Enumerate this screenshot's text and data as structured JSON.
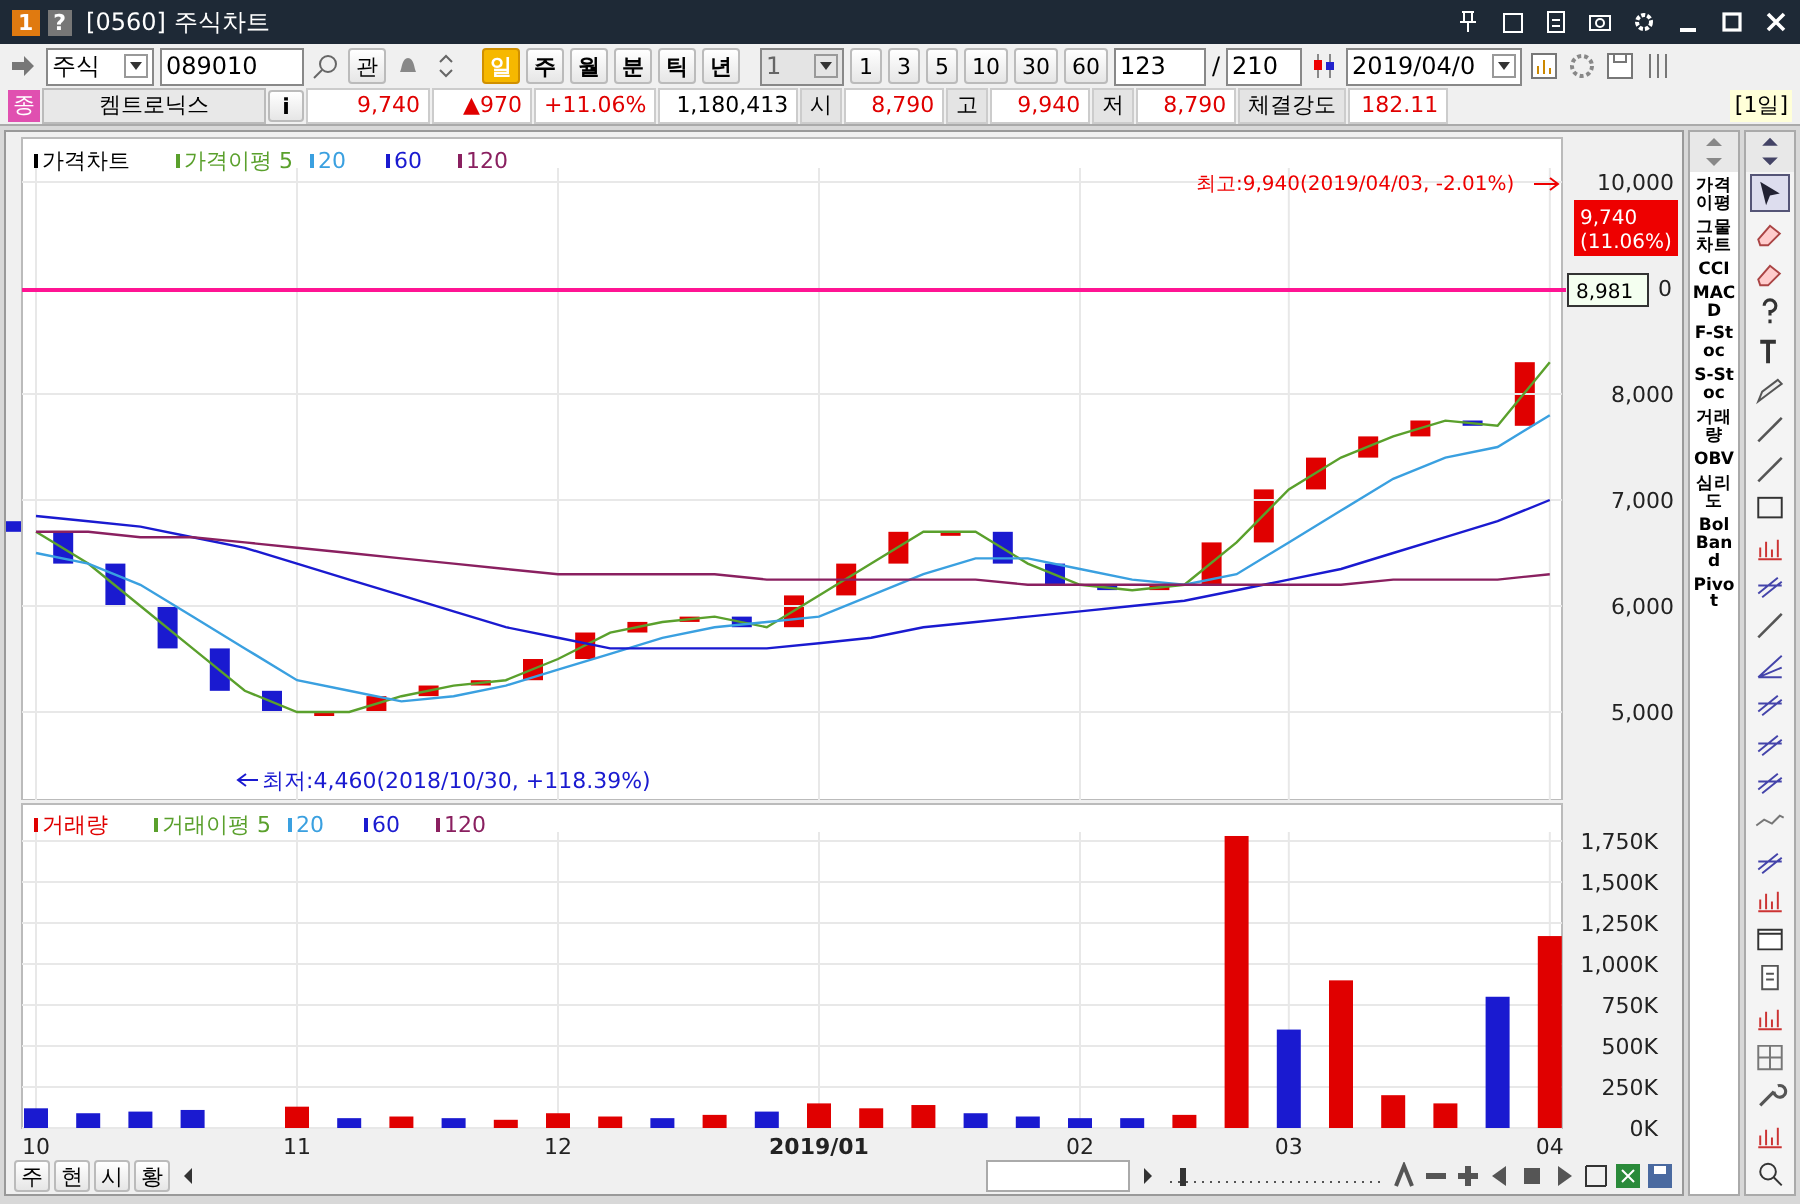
{
  "window": {
    "badge": "1",
    "help": "?",
    "title": "[0560] 주식차트"
  },
  "toolbar": {
    "market": "주식",
    "code": "089010",
    "bookmark": "관",
    "periods": [
      {
        "label": "일",
        "selected": true
      },
      {
        "label": "주",
        "selected": false
      },
      {
        "label": "월",
        "selected": false
      },
      {
        "label": "분",
        "selected": false
      },
      {
        "label": "틱",
        "selected": false
      },
      {
        "label": "년",
        "selected": false
      }
    ],
    "unit": "1",
    "intervals": [
      "1",
      "3",
      "5",
      "10",
      "30",
      "60"
    ],
    "view_count": "123",
    "separator": "/",
    "total_count": "210",
    "date": "2019/04/0"
  },
  "quote": {
    "badge": "종",
    "name": "켐트로닉스",
    "info": "i",
    "price": "9,740",
    "change": "▲970",
    "rate": "+11.06%",
    "volume": "1,180,413",
    "fields": [
      {
        "label": "시",
        "value": "8,790"
      },
      {
        "label": "고",
        "value": "9,940"
      },
      {
        "label": "저",
        "value": "8,790"
      },
      {
        "label": "체결강도",
        "value": "182.11"
      }
    ],
    "period_label": "[1일]"
  },
  "price_chart": {
    "title": {
      "label": "가격차트",
      "color": "#000000"
    },
    "high_label": "최고:9,940(2019/04/03, -2.01%)",
    "low_label": "최저:4,460(2018/10/30, +118.39%)",
    "last_price": "9,740",
    "last_change": "(11.06%)",
    "axis_fragment": "0",
    "chart_data": {
      "type": "line",
      "ylim": [
        4170,
        10415
      ],
      "grid": true,
      "legend": "upper left",
      "yticks": [
        {
          "value": 5000,
          "label": "5,000"
        },
        {
          "value": 6000,
          "label": "6,000"
        },
        {
          "value": 7000,
          "label": "7,000"
        },
        {
          "value": 8000,
          "label": "8,000"
        },
        {
          "value": 10000,
          "label": "10,000"
        }
      ],
      "ref_lines": [
        {
          "axis": "y",
          "value": 8981,
          "label": "8,981",
          "color": "#ff1493"
        }
      ],
      "series": [
        {
          "name": "가격이평 5",
          "color": "#5aa02c",
          "values": [
            6700,
            6400,
            6000,
            5600,
            5200,
            5000,
            5000,
            5150,
            5250,
            5300,
            5500,
            5750,
            5850,
            5900,
            5800,
            6100,
            6400,
            6700,
            6700,
            6400,
            6200,
            6150,
            6200,
            6600,
            7100,
            7400,
            7600,
            7750,
            7700,
            8300
          ]
        },
        {
          "name": "20",
          "color": "#3aa0e0",
          "values": [
            6500,
            6400,
            6200,
            5900,
            5600,
            5300,
            5200,
            5100,
            5150,
            5250,
            5400,
            5550,
            5700,
            5800,
            5850,
            5900,
            6100,
            6300,
            6450,
            6450,
            6350,
            6250,
            6200,
            6300,
            6600,
            6900,
            7200,
            7400,
            7500,
            7800
          ]
        },
        {
          "name": "60",
          "color": "#1a1ad0",
          "values": [
            6850,
            6800,
            6750,
            6650,
            6550,
            6400,
            6250,
            6100,
            5950,
            5800,
            5700,
            5600,
            5600,
            5600,
            5600,
            5650,
            5700,
            5800,
            5850,
            5900,
            5950,
            6000,
            6050,
            6150,
            6250,
            6350,
            6500,
            6650,
            6800,
            7000
          ]
        },
        {
          "name": "120",
          "color": "#8a2060",
          "values": [
            6700,
            6700,
            6650,
            6650,
            6600,
            6550,
            6500,
            6450,
            6400,
            6350,
            6300,
            6300,
            6300,
            6300,
            6250,
            6250,
            6250,
            6250,
            6250,
            6200,
            6200,
            6200,
            6200,
            6200,
            6200,
            6200,
            6250,
            6250,
            6250,
            6300
          ]
        }
      ]
    }
  },
  "volume_chart": {
    "legend": [
      {
        "label": "거래이평 5",
        "color": "#5aa02c"
      },
      {
        "label": "20",
        "color": "#3aa0e0"
      },
      {
        "label": "60",
        "color": "#1a1ad0"
      },
      {
        "label": "120",
        "color": "#8a2060"
      }
    ],
    "chart_data": {
      "type": "bar",
      "ylim": [
        0,
        1975
      ],
      "grid": true,
      "stacked": true,
      "categories": [
        "10",
        null,
        null,
        null,
        null,
        "11",
        null,
        null,
        null,
        null,
        "12",
        null,
        null,
        null,
        null,
        "2019/01",
        null,
        null,
        null,
        null,
        "02",
        null,
        null,
        null,
        "03",
        null,
        null,
        null,
        null,
        "04"
      ],
      "yticks": [
        {
          "value": 0,
          "label": "0K"
        },
        {
          "value": 250,
          "label": "250K"
        },
        {
          "value": 500,
          "label": "500K"
        },
        {
          "value": 750,
          "label": "750K"
        },
        {
          "value": 1000,
          "label": "1,000K"
        },
        {
          "value": 1250,
          "label": "1,250K"
        },
        {
          "value": 1500,
          "label": "1,500K"
        },
        {
          "value": 1750,
          "label": "1,750K"
        }
      ],
      "series": [
        {
          "name": "거래량",
          "color": "#e00000",
          "values": [
            null,
            null,
            null,
            null,
            null,
            130,
            null,
            70,
            null,
            50,
            90,
            70,
            null,
            80,
            null,
            150,
            120,
            140,
            null,
            null,
            null,
            null,
            80,
            1780,
            null,
            900,
            200,
            150,
            null,
            1170
          ]
        },
        {
          "color": "#1a1ad0",
          "values": [
            120,
            90,
            100,
            110,
            null,
            null,
            60,
            null,
            60,
            null,
            null,
            null,
            60,
            null,
            100,
            null,
            null,
            null,
            90,
            70,
            60,
            60,
            null,
            null,
            600,
            null,
            null,
            null,
            800,
            null
          ]
        }
      ]
    }
  },
  "bottom": {
    "tabs": [
      "주",
      "현",
      "시",
      "황"
    ],
    "zoom": {
      "level": 0.05
    }
  },
  "indicators": [
    "가격이평",
    "그물차트",
    "CCI",
    "MACD",
    "F-Stoc",
    "S-Stoc",
    "거래량",
    "OBV",
    "심리도",
    "Bol Band",
    "Pivot"
  ]
}
